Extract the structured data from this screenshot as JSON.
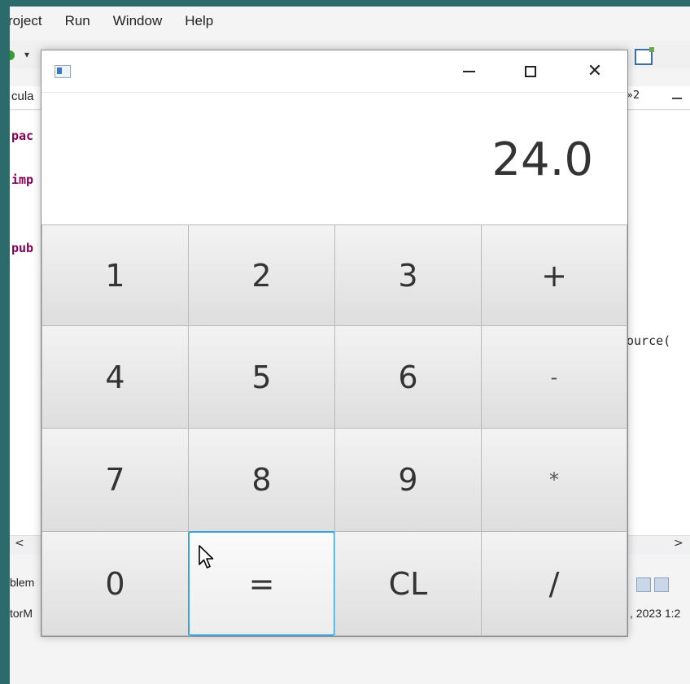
{
  "ide": {
    "menu": [
      "roject",
      "Run",
      "Window",
      "Help"
    ],
    "tab_label": "cula",
    "tab_marker": "2",
    "code_lines": [
      "pac",
      "imp",
      "pub"
    ],
    "code_fragment": "ource(",
    "lower_tab": "blem",
    "status_left": "torM",
    "status_right": ", 2023 1:2"
  },
  "calculator": {
    "display": "24.0",
    "keys": [
      [
        "1",
        "2",
        "3",
        "+"
      ],
      [
        "4",
        "5",
        "6",
        "-"
      ],
      [
        "7",
        "8",
        "9",
        "*"
      ],
      [
        "0",
        "=",
        "CL",
        "/"
      ]
    ]
  },
  "icons": {
    "window_icon": "app-icon",
    "minimize": "minimize-icon",
    "maximize": "maximize-icon",
    "close": "close-icon",
    "pointer": "mouse-pointer-icon"
  },
  "colors": {
    "focus_border": "#3aa3d9",
    "desktop": "#2c6b6b",
    "keyword": "#7f0055"
  }
}
